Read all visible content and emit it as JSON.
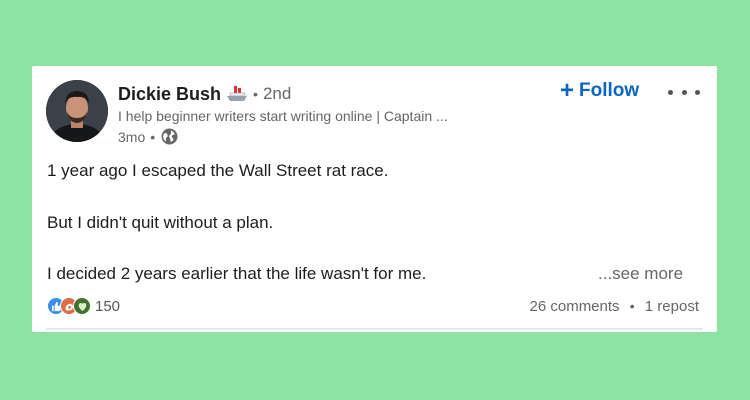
{
  "post": {
    "author": {
      "name": "Dickie Bush",
      "connection_degree": "2nd",
      "headline": "I help beginner writers start writing online | Captain ...",
      "badge_icon": "ship-icon"
    },
    "age": "3mo",
    "visibility_icon": "globe-icon",
    "follow_label": "Follow",
    "follow_color": "#0a66c2",
    "body_lines": [
      "1 year ago I escaped the Wall Street rat race.",
      "But I didn't quit without a plan.",
      "I decided 2 years earlier that the life wasn't for me."
    ],
    "see_more_label": "...see more",
    "reactions": {
      "icons": [
        "like-icon",
        "celebrate-icon",
        "support-icon"
      ],
      "count": "150"
    },
    "comments": "26 comments",
    "reposts": "1 repost",
    "separator": "•"
  },
  "colors": {
    "background": "#8de3a2",
    "card": "#ffffff",
    "accent": "#0a66c2"
  }
}
